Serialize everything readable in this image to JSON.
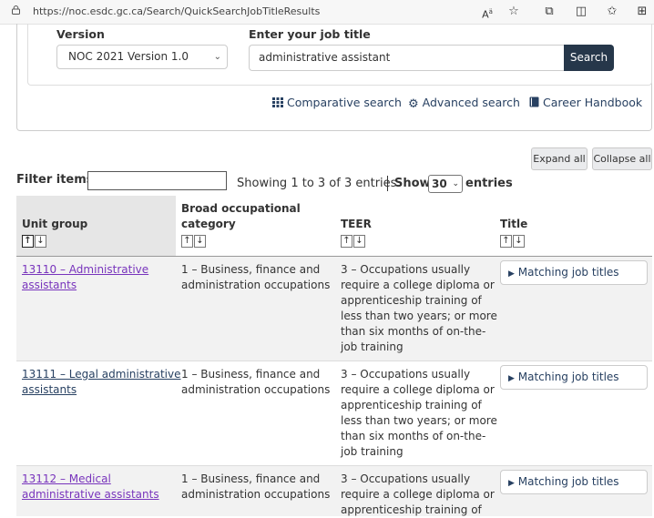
{
  "browser": {
    "url": "https://noc.esdc.gc.ca/Search/QuickSearchJobTitleResults",
    "icons": [
      "read-aloud-icon",
      "favorite-star-icon",
      "extensions-icon",
      "split-screen-icon",
      "favorites-icon",
      "collections-icon"
    ]
  },
  "search": {
    "version_label": "Version",
    "version_value": "NOC 2021 Version 1.0",
    "job_title_label": "Enter your job title",
    "job_title_value": "administrative assistant",
    "search_button": "Search",
    "links": {
      "comparative": "Comparative search",
      "advanced": "Advanced search",
      "handbook": "Career Handbook"
    }
  },
  "controls": {
    "expand_all": "Expand all",
    "collapse_all": "Collapse all",
    "filter_label": "Filter items",
    "filter_value": "",
    "showing": "Showing 1 to 3 of 3 entries",
    "show_label": "Show",
    "show_value": "30",
    "entries_label": "entries"
  },
  "table": {
    "headers": {
      "unit_group": "Unit group",
      "broad_1": "Broad occupational",
      "broad_2": "category",
      "teer": "TEER",
      "title": "Title"
    },
    "sort_arrows": {
      "up": "↑",
      "down": "↓"
    },
    "rows": [
      {
        "unit_1": "13110 – Administrative",
        "unit_2": "assistants",
        "broad_1": "1 – Business, finance and",
        "broad_2": "administration occupations",
        "teer": [
          "3 – Occupations usually",
          "require a college diploma or",
          "apprenticeship training of",
          "less than two years; or more",
          "than six months of on-the-",
          "job training"
        ],
        "button": "Matching job titles"
      },
      {
        "unit_1": "13111 – Legal administrative",
        "unit_2": "assistants",
        "broad_1": "1 – Business, finance and",
        "broad_2": "administration occupations",
        "teer": [
          "3 – Occupations usually",
          "require a college diploma or",
          "apprenticeship training of",
          "less than two years; or more",
          "than six months of on-the-",
          "job training"
        ],
        "button": "Matching job titles"
      },
      {
        "unit_1": "13112 – Medical",
        "unit_2": "administrative assistants",
        "broad_1": "1 – Business, finance and",
        "broad_2": "administration occupations",
        "teer": [
          "3 – Occupations usually",
          "require a college diploma or",
          "apprenticeship training of"
        ],
        "button": "Matching job titles"
      }
    ]
  }
}
